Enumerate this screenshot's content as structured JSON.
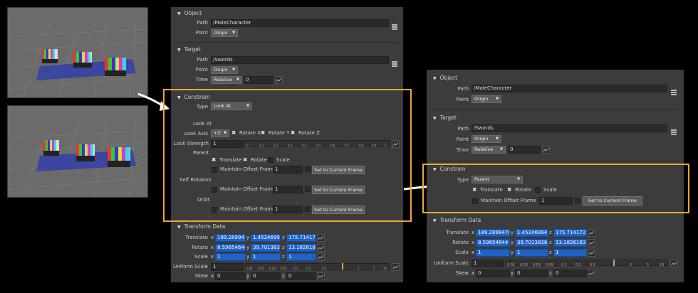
{
  "left_panel": {
    "object": {
      "title": "Object",
      "path_label": "Path",
      "path_value": "/MaleCharacter",
      "point_label": "Point",
      "point_value": "Origin"
    },
    "target": {
      "title": "Target",
      "path_label": "Path",
      "path_value": "/Swords",
      "point_label": "Point",
      "point_value": "Origin",
      "time_label": "Time",
      "time_mode": "Relative",
      "time_value": "0"
    },
    "constrain": {
      "title": "Constrain",
      "type_label": "Type",
      "type_value": "Look At",
      "look_at_heading": "Look At",
      "look_axis_label": "Look Axis",
      "look_axis_value": "+Z",
      "rotate_x": "Rotate X",
      "rotate_y": "Rotate Y",
      "rotate_z": "Rotate Z",
      "look_strength_label": "Look Strength",
      "look_strength_value": "1",
      "parent_heading": "Parent",
      "translate": "Translate",
      "rotate": "Rotate",
      "scale": "Scale",
      "maintain_offset": "Maintain Offset Frame",
      "offset_value": "1",
      "set_current": "Set to Current Frame",
      "self_rotation_heading": "Self Rotation",
      "orbit_heading": "Orbit",
      "slider_ticks": [
        "0",
        "0.1",
        "0.2",
        "0.3",
        "0.4",
        "0.5",
        "0.6",
        "0.7",
        "0.8",
        "0.9",
        "1"
      ]
    },
    "transform": {
      "title": "Transform Data",
      "translate_label": "Translate",
      "translate_x": "189.289947(",
      "translate_y": "1.45246994",
      "translate_z": "175.714172:",
      "rotate_label": "Rotate",
      "rotate_x": "8.59654644",
      "rotate_y": "39.7013838",
      "rotate_z": "13.1826183!",
      "scale_label": "Scale",
      "scale_x": "1",
      "scale_y": "1",
      "scale_z": "1",
      "uniform_label": "Uniform Scale",
      "uniform_value": "1",
      "uniform_ticks": [
        "0.01",
        "0.02",
        "0.03",
        "0.05",
        "0.1",
        "0.2",
        "0.5",
        "1",
        "2",
        "5",
        "10"
      ],
      "skew_label": "Skew",
      "skew_x": "0",
      "skew_y": "0",
      "skew_z": "0",
      "axis_x": "x",
      "axis_y": "y",
      "axis_z": "z"
    }
  },
  "right_panel": {
    "object": {
      "title": "Object",
      "path_label": "Path",
      "path_value": "/MaleCharacter",
      "point_label": "Point",
      "point_value": "Origin"
    },
    "target": {
      "title": "Target",
      "path_label": "Path",
      "path_value": "/Swords",
      "point_label": "Point",
      "point_value": "Origin",
      "time_label": "Time",
      "time_mode": "Relative",
      "time_value": "0"
    },
    "constrain": {
      "title": "Constrain",
      "type_label": "Type",
      "type_value": "Parent",
      "translate": "Translate",
      "rotate": "Rotate",
      "scale": "Scale",
      "maintain_offset": "Maintain Offset Frame",
      "offset_value": "1",
      "set_current": "Set to Current Frame"
    },
    "transform": {
      "title": "Transform Data",
      "translate_label": "Translate",
      "translate_x": "189.289947(",
      "translate_y": "1.45246994",
      "translate_z": "175.714172:",
      "rotate_label": "Rotate",
      "rotate_x": "8.59654644",
      "rotate_y": "39.7013838",
      "rotate_z": "13.1826183!",
      "scale_label": "Scale",
      "scale_x": "1",
      "scale_y": "1",
      "scale_z": "1",
      "uniform_label": "Uniform Scale",
      "uniform_value": "1",
      "uniform_ticks": [
        "0.01",
        "0.02",
        "0.03",
        "0.05",
        "0.1",
        "0.2",
        "0.5",
        "1",
        "2",
        "5",
        "10"
      ],
      "skew_label": "Skew",
      "skew_x": "0",
      "skew_y": "0",
      "skew_z": "0",
      "axis_x": "x",
      "axis_y": "y",
      "axis_z": "z"
    }
  },
  "colors": {
    "highlight": "#f0a830",
    "panel_bg": "#3c3c3c",
    "field_blue": "#1e62c8"
  }
}
